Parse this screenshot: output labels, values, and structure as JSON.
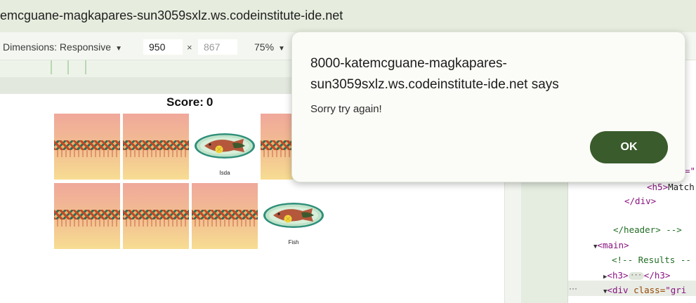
{
  "urlbar": {
    "url": "emcguane-magkapares-sun3059sxlz.ws.codeinstitute-ide.net"
  },
  "devtools_toolbar": {
    "dimensions_label": "Dimensions: Responsive",
    "dimensions_caret": "▼",
    "width_value": "950",
    "height_placeholder": "867",
    "times": "×",
    "zoom_label": "75%",
    "zoom_caret": "▼"
  },
  "game": {
    "score_label": "Score:",
    "score_value": "0",
    "cards": [
      {
        "state": "back",
        "label": ""
      },
      {
        "state": "back",
        "label": ""
      },
      {
        "state": "face",
        "label": "Isda",
        "image": "fish-plate"
      },
      {
        "state": "back",
        "label": ""
      },
      {
        "state": "back",
        "label": ""
      },
      {
        "state": "back",
        "label": ""
      },
      {
        "state": "back",
        "label": ""
      },
      {
        "state": "face",
        "label": "Fish",
        "image": "fish-plate"
      }
    ]
  },
  "dialog": {
    "title": "8000-katemcguane-magkapares-sun3059sxlz.ws.codeinstitute-ide.net says",
    "message": "Sorry try again!",
    "ok_label": "OK"
  },
  "elements_panel": {
    "line1": "=\"]",
    "line2_tag": "<h5>",
    "line2_text": "Match",
    "line3": "</div>",
    "line4": "</header> -->",
    "line5": "<main>",
    "line6": "<!-- Results --",
    "line7_open": "<h3>",
    "line7_dots": "···",
    "line7_close": "</h3>",
    "line8_tag": "<div ",
    "line8_attr": "class=",
    "line8_val": "\"gri",
    "more_dots": "···"
  },
  "colors": {
    "urlbar_bg": "#e6edde",
    "ok_button": "#3a5b2c",
    "dialog_bg": "#fbfcf7"
  }
}
